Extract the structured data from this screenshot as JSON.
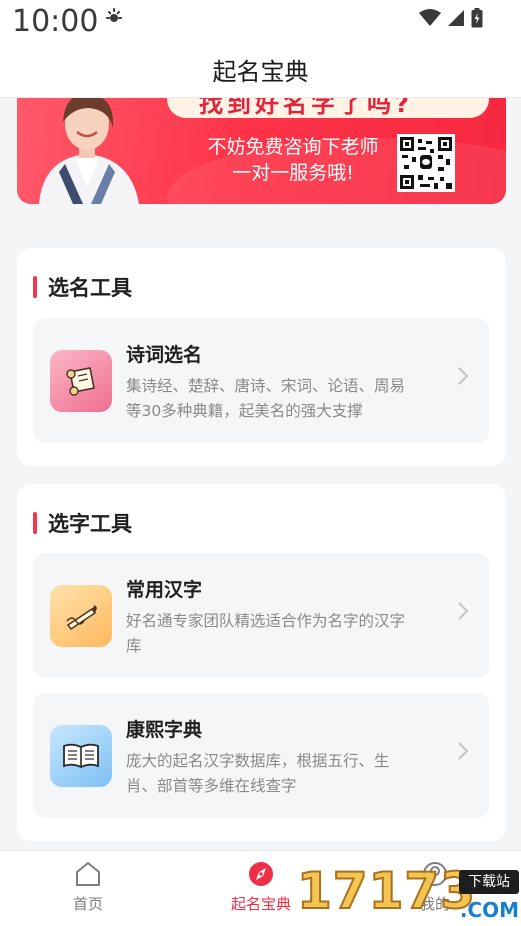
{
  "status_bar": {
    "time": "10:00"
  },
  "header": {
    "title": "起名宝典"
  },
  "banner": {
    "headline": "找到好名字了吗?",
    "line1": "不妨免费咨询下老师",
    "line2": "一对一服务哦!"
  },
  "sections": {
    "select_name": {
      "title": "选名工具",
      "items": [
        {
          "name": "诗词选名",
          "desc_line1": "集诗经、楚辞、唐诗、宋词、论语、周易",
          "desc_line2": "等30多种典籍，起美名的强大支撑"
        }
      ]
    },
    "select_char": {
      "title": "选字工具",
      "items": [
        {
          "name": "常用汉字",
          "desc_line1": "好名通专家团队精选适合作为名字的汉字",
          "desc_line2": "库"
        },
        {
          "name": "康熙字典",
          "desc_line1": "庞大的起名汉字数据库，根据五行、生",
          "desc_line2": "肖、部首等多维在线查字"
        }
      ]
    }
  },
  "bottom_nav": {
    "items": [
      {
        "label": "首页",
        "active": false
      },
      {
        "label": "起名宝典",
        "active": true
      },
      {
        "label": "我的",
        "active": false
      }
    ]
  },
  "watermark": {
    "number": "17173",
    "badge": "下载站",
    "domain": ".COM"
  },
  "colors": {
    "accent": "#ef2f47",
    "banner": "#ff3348"
  }
}
